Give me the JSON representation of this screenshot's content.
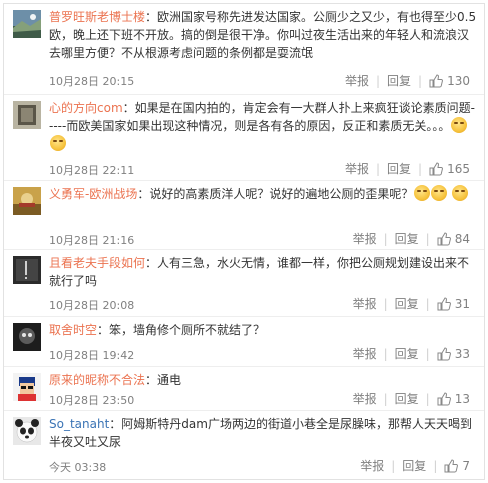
{
  "actions": {
    "report": "举报",
    "reply": "回复"
  },
  "comments": [
    {
      "user": "普罗旺斯老博士楼",
      "text": "：欧洲国家号称先进发达国家。公厕少之又少，有也得至少0.5欧，晚上还下班不开放。搞的倒是很干净。你叫过夜生活出来的年轻人和流浪汉去哪里方便？不从根源考虑问题的条例都是耍流氓",
      "time": "10月28日 20:15",
      "likes": "130",
      "emoji_count": 0
    },
    {
      "user": "心的方向com",
      "text": "：如果是在国内拍的，肯定会有一大群人扑上来疯狂谈论素质问题-----而欧美国家如果出现这种情况，则是各有各的原因，反正和素质无关。。。",
      "time": "10月28日 22:11",
      "likes": "165",
      "emoji_count": 2
    },
    {
      "user": "义勇军-欧洲战场",
      "text": "：说好的高素质洋人呢？说好的遍地公厕的歪果呢？",
      "time": "10月28日 21:16",
      "likes": "84",
      "emoji_count": 3
    },
    {
      "user": "且看老夫手段如何",
      "text": "：人有三急，水火无情，谁都一样，你把公厕规划建设出来不就行了吗",
      "time": "10月28日 20:08",
      "likes": "31",
      "emoji_count": 0
    },
    {
      "user": "取舍时空",
      "text": "：笨，墙角修个厕所不就结了？",
      "time": "10月28日 19:42",
      "likes": "33",
      "emoji_count": 0
    },
    {
      "user": "原来的昵称不合法",
      "text": "：通电",
      "time": "10月28日 23:50",
      "likes": "13",
      "emoji_count": 0
    },
    {
      "user": "So_tanaht",
      "text": "：阿姆斯特丹dam广场两边的街道小巷全是尿臊味，那帮人天天喝到半夜又吐又尿",
      "time": "今天 03:38",
      "likes": "7",
      "emoji_count": 0
    }
  ],
  "colors": {
    "username": "#eb7350",
    "username_alt": "#3b74b5",
    "meta": "#808080",
    "border": "#eeeeee"
  }
}
